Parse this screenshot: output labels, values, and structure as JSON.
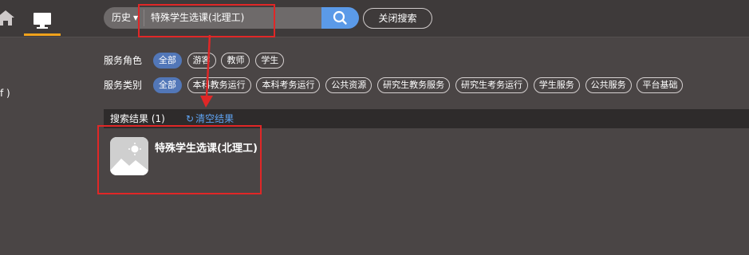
{
  "nav": {
    "home_icon": "home-icon",
    "desktop_icon": "desktop-icon",
    "active_underline_color": "#f0a21c"
  },
  "search": {
    "history_label": "历史",
    "query": "特殊学生选课(北理工)",
    "search_icon": "search-icon",
    "close_label": "关闭搜索"
  },
  "left_fragment": "f )",
  "filters": [
    {
      "label": "服务角色",
      "options": [
        "全部",
        "游客",
        "教师",
        "学生"
      ],
      "selected": "全部"
    },
    {
      "label": "服务类别",
      "options": [
        "全部",
        "本科教务运行",
        "本科考务运行",
        "公共资源",
        "研究生教务服务",
        "研究生考务运行",
        "学生服务",
        "公共服务",
        "平台基础"
      ],
      "selected": "全部"
    }
  ],
  "results": {
    "title": "搜索结果 (1)",
    "clear_label": "清空结果",
    "items": [
      {
        "name": "特殊学生选课(北理工)",
        "thumb_icon": "image-placeholder-icon"
      }
    ]
  },
  "colors": {
    "accent_blue": "#5b9ae8",
    "chip_active": "#5277b8",
    "annotation_red": "#e02727",
    "link_blue": "#5fa3f2"
  }
}
